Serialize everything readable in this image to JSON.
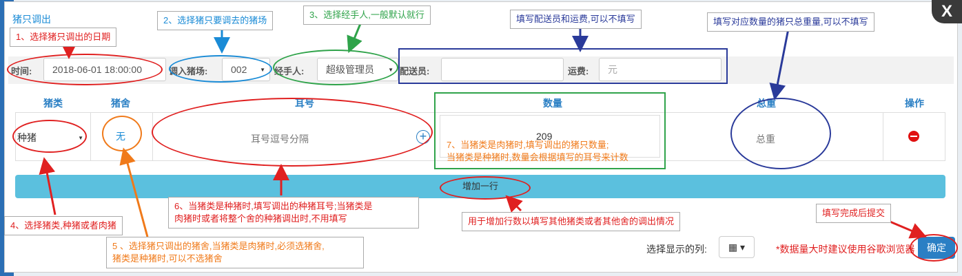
{
  "modal_title": "猪只调出",
  "filter": {
    "time_label": "时间:",
    "time_value": "2018-06-01 18:00:00",
    "farm_label": "调入猪场:",
    "farm_value": "002",
    "handler_label": "经手人:",
    "handler_value": "超级管理员",
    "courier_label": "配送员:",
    "courier_value": "",
    "fee_label": "运费:",
    "fee_placeholder": "元"
  },
  "table": {
    "headers": [
      "猪类",
      "猪舍",
      "耳号",
      "数量",
      "总重",
      "操作"
    ],
    "row": {
      "pig_type": "种猪",
      "pen": "无",
      "ear_placeholder": "耳号逗号分隔",
      "quantity": "209",
      "weight_placeholder": "总重"
    }
  },
  "add_row_label": "增加一行",
  "footer": {
    "columns_label": "选择显示的列:",
    "tip": "*数据量大时建议使用谷歌浏览器",
    "confirm_label": "确定"
  },
  "close_label": "X",
  "annotations": {
    "a1": "1、选择猪只调出的日期",
    "a2": "2、选择猪只要调去的猪场",
    "a3": "3、选择经手人,一般默认就行",
    "a_courier": "填写配送员和运费,可以不填写",
    "a_weight": "填写对应数量的猪只总重量,可以不填写",
    "a4": "4、选择猪类,种猪或者肉猪",
    "a5_l1": "5 、选择猪只调出的猪舍,当猪类是肉猪时,必须选猪舍,",
    "a5_l2": "猪类是种猪时,可以不选猪舍",
    "a6_l1": "6、当猪类是种猪时,填写调出的种猪耳号;当猪类是",
    "a6_l2": "肉猪时或者将整个舍的种猪调出时,不用填写",
    "a7_l1": "7、当猪类是肉猪时,填写调出的猪只数量;",
    "a7_l2": "当猪类是种猪时,数量会根据填写的耳号来计数",
    "a_addrow": "用于增加行数以填写其他猪类或者其他舍的调出情况",
    "a_submit": "填写完成后提交"
  },
  "colors": {
    "red": "#e02020",
    "blue": "#1a8bd6",
    "green": "#2fa34a",
    "navy": "#2a3a9a",
    "orange": "#f07a1a"
  }
}
